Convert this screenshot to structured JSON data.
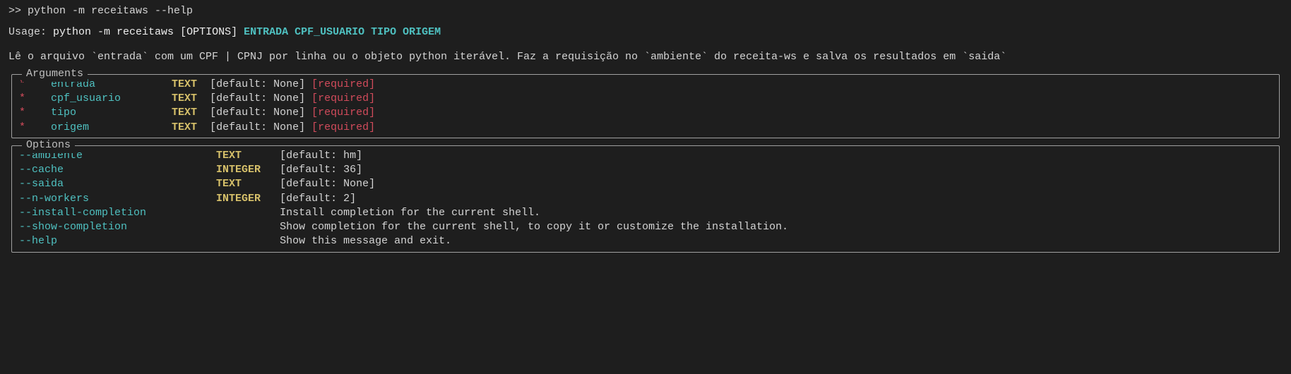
{
  "prompt": ">> python -m receitaws --help",
  "usage": {
    "label": "Usage:",
    "command": "python -m receitaws",
    "optlabel": "[OPTIONS]",
    "args": "ENTRADA CPF_USUARIO TIPO ORIGEM"
  },
  "description": "Lê o arquivo `entrada` com um CPF | CPNJ por linha ou o objeto python iterável. Faz a requisição no `ambiente` do receita-ws e salva os resultados em `saida`",
  "arguments": {
    "title": "Arguments",
    "rows": [
      {
        "star": "*",
        "name": "entrada",
        "type": "TEXT",
        "default": "[default: None]",
        "required": "[required]"
      },
      {
        "star": "*",
        "name": "cpf_usuario",
        "type": "TEXT",
        "default": "[default: None]",
        "required": "[required]"
      },
      {
        "star": "*",
        "name": "tipo",
        "type": "TEXT",
        "default": "[default: None]",
        "required": "[required]"
      },
      {
        "star": "*",
        "name": "origem",
        "type": "TEXT",
        "default": "[default: None]",
        "required": "[required]"
      }
    ]
  },
  "options": {
    "title": "Options",
    "rows": [
      {
        "name": "--ambiente",
        "type": "TEXT",
        "desc": "[default: hm]"
      },
      {
        "name": "--cache",
        "type": "INTEGER",
        "desc": "[default: 36]"
      },
      {
        "name": "--saida",
        "type": "TEXT",
        "desc": "[default: None]"
      },
      {
        "name": "--n-workers",
        "type": "INTEGER",
        "desc": "[default: 2]"
      },
      {
        "name": "--install-completion",
        "type": "",
        "desc": "Install completion for the current shell."
      },
      {
        "name": "--show-completion",
        "type": "",
        "desc": "Show completion for the current shell, to copy it or customize the installation."
      },
      {
        "name": "--help",
        "type": "",
        "desc": "Show this message and exit."
      }
    ]
  }
}
